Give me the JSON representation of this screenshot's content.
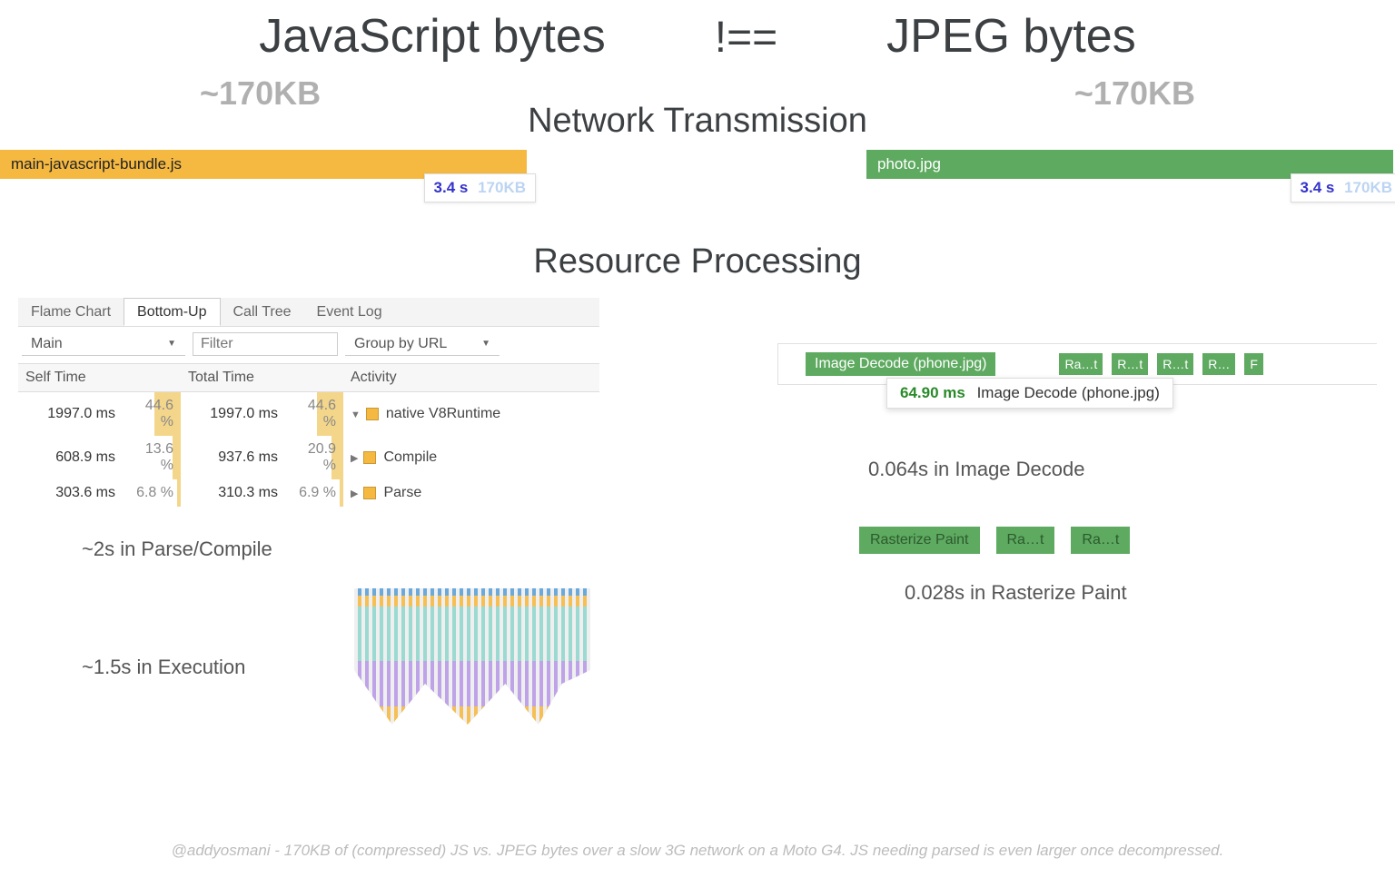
{
  "headline": {
    "left": "JavaScript bytes",
    "op": "!==",
    "right": "JPEG bytes"
  },
  "sizes": {
    "left": "~170KB",
    "right": "~170KB"
  },
  "sections": {
    "network": "Network Transmission",
    "processing": "Resource Processing"
  },
  "bars": {
    "left": {
      "file": "main-javascript-bundle.js",
      "time": "3.4 s",
      "size": "170KB"
    },
    "right": {
      "file": "photo.jpg",
      "time": "3.4 s",
      "size": "170KB"
    }
  },
  "devtools": {
    "tabs": [
      "Flame Chart",
      "Bottom-Up",
      "Call Tree",
      "Event Log"
    ],
    "activeTabIndex": 1,
    "thread": "Main",
    "filterPlaceholder": "Filter",
    "groupBy": "Group by URL",
    "columns": [
      "Self Time",
      "Total Time",
      "Activity"
    ],
    "rows": [
      {
        "self_ms": "1997.0 ms",
        "self_pct": "44.6 %",
        "self_pct_num": 44.6,
        "total_ms": "1997.0 ms",
        "total_pct": "44.6 %",
        "total_pct_num": 44.6,
        "activity": "native V8Runtime",
        "expand": "▼"
      },
      {
        "self_ms": "608.9 ms",
        "self_pct": "13.6 %",
        "self_pct_num": 13.6,
        "total_ms": "937.6 ms",
        "total_pct": "20.9 %",
        "total_pct_num": 20.9,
        "activity": "Compile",
        "expand": "▶"
      },
      {
        "self_ms": "303.6 ms",
        "self_pct": "6.8 %",
        "self_pct_num": 6.8,
        "total_ms": "310.3 ms",
        "total_pct": "6.9 %",
        "total_pct_num": 6.9,
        "activity": "Parse",
        "expand": "▶"
      }
    ],
    "summary_parse": "~2s in Parse/Compile",
    "summary_exec": "~1.5s in Execution"
  },
  "decode": {
    "chip_main": "Image Decode (phone.jpg)",
    "chips_small": [
      "Ra…t",
      "R…t",
      "R…t",
      "R…",
      "F"
    ],
    "tooltip_ms": "64.90 ms",
    "tooltip_label": "Image Decode (phone.jpg)",
    "summary": "0.064s in Image Decode"
  },
  "rasterize": {
    "chips": [
      "Rasterize Paint",
      "Ra…t",
      "Ra…t"
    ],
    "summary": "0.028s in Rasterize Paint"
  },
  "footer": "@addyosmani - 170KB of (compressed) JS vs. JPEG bytes over a slow 3G network on a Moto G4. JS needing parsed is even larger once decompressed."
}
